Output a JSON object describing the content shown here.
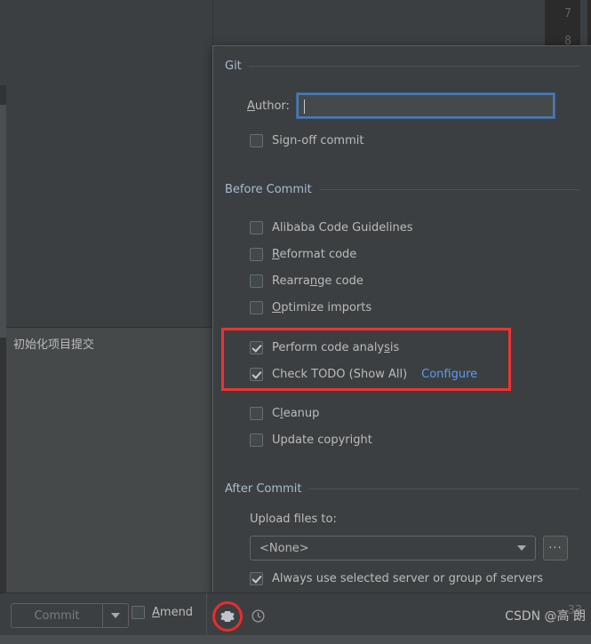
{
  "editor": {
    "gutter_lines": [
      "7",
      "8"
    ]
  },
  "left_panel": {
    "commit_message": "初始化项目提交"
  },
  "dialog": {
    "sections": [
      {
        "id": "git",
        "title": "Git",
        "author_label_prefix": "",
        "author_label_mnemonic": "A",
        "author_label_suffix": "uthor:",
        "author_value": "",
        "author_placeholder": "",
        "sign_off": {
          "label": "Sign-off commit",
          "checked": false
        }
      },
      {
        "id": "before-commit",
        "title": "Before Commit"
      },
      {
        "id": "after-commit",
        "title": "After Commit"
      }
    ],
    "before_commit_items": [
      {
        "pre": "Alibaba Code Guidelines",
        "mnemonic": "",
        "post": "",
        "checked": false,
        "link": ""
      },
      {
        "pre": "",
        "mnemonic": "R",
        "post": "eformat code",
        "checked": false,
        "link": ""
      },
      {
        "pre": "Rearra",
        "mnemonic": "n",
        "post": "ge code",
        "checked": false,
        "link": ""
      },
      {
        "pre": "",
        "mnemonic": "O",
        "post": "ptimize imports",
        "checked": false,
        "link": ""
      },
      {
        "pre": "Perform code analy",
        "mnemonic": "s",
        "post": "is",
        "checked": true,
        "link": ""
      },
      {
        "pre": "Check TODO (Show All)",
        "mnemonic": "",
        "post": "",
        "checked": true,
        "link": "Configure"
      },
      {
        "pre": "C",
        "mnemonic": "l",
        "post": "eanup",
        "checked": false,
        "link": ""
      },
      {
        "pre": "Update copyright",
        "mnemonic": "",
        "post": "",
        "checked": false,
        "link": ""
      }
    ],
    "after_commit": {
      "upload_label": "Upload files to:",
      "upload_value": "<None>",
      "browse_label": "...",
      "always_use_server": {
        "label": "Always use selected server or group of servers",
        "checked": true
      }
    }
  },
  "toolbar": {
    "commit_label": "Commit",
    "amend_prefix": "",
    "amend_mnemonic": "A",
    "amend_suffix": "mend",
    "amend_checked": false,
    "gear_icon": "gear-icon",
    "history_icon": "clock-icon",
    "dropdown_icon": "chevron-down-icon"
  },
  "watermark": {
    "text": "CSDN @高 朗",
    "shadow_text": "33"
  },
  "colors": {
    "background": "#3c3f41",
    "panel": "#45494a",
    "accent_blue": "#589df6",
    "focus_border": "#4a7ab5",
    "highlight_red": "#f2322e",
    "section_title": "#a7bcd1",
    "text": "#bbbbbb"
  }
}
